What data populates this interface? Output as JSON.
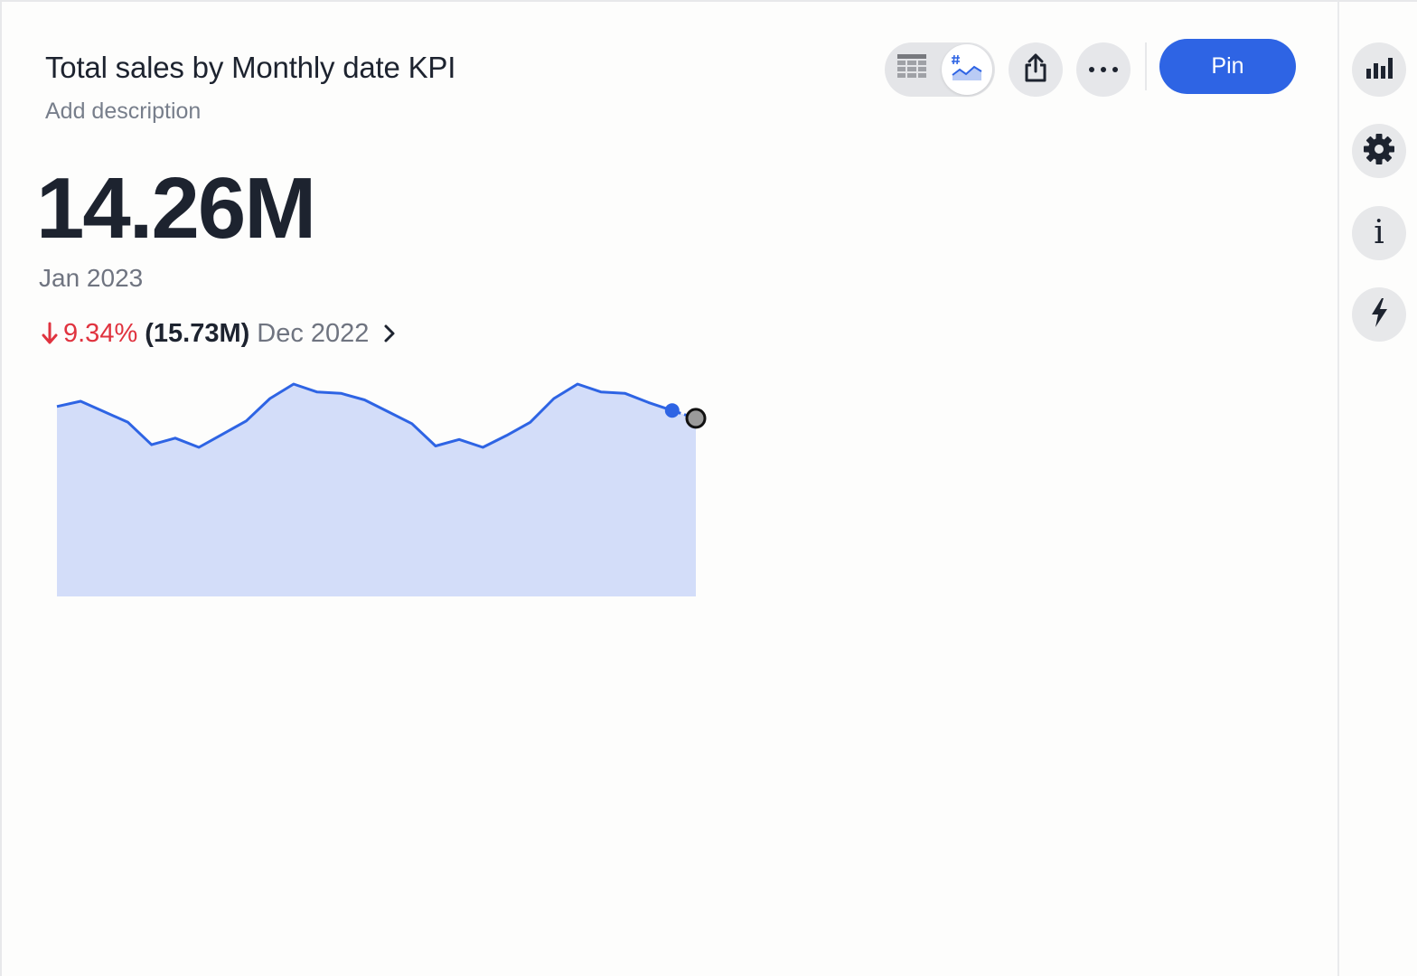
{
  "header": {
    "title": "Total sales by Monthly date KPI",
    "description": "Add description"
  },
  "kpi": {
    "value": "14.26M",
    "period": "Jan 2023",
    "change": {
      "direction": "down",
      "percent": "9.34%",
      "previous_value": "(15.73M)",
      "previous_period": "Dec 2022"
    }
  },
  "toolbar": {
    "view_toggle": {
      "options": [
        "table",
        "kpi"
      ],
      "selected": "kpi"
    },
    "share_icon": "share-icon",
    "more_icon": "more-icon",
    "pin_label": "Pin"
  },
  "side_rail": {
    "items": [
      "chart-icon",
      "gear-icon",
      "info-icon",
      "bolt-icon"
    ],
    "info_glyph": "i"
  },
  "colors": {
    "accent": "#2e64e4",
    "negative": "#e0333f",
    "area_fill": "#d3ddf9",
    "line": "#2e64e4"
  },
  "chart_data": {
    "type": "area",
    "values": [
      14.9,
      15.3,
      14.5,
      13.7,
      12.0,
      12.5,
      11.8,
      12.8,
      13.8,
      15.5,
      16.6,
      16.0,
      15.9,
      15.4,
      14.5,
      13.6,
      11.9,
      12.4,
      11.8,
      12.7,
      13.7,
      15.5,
      16.6,
      16.0,
      15.9,
      15.2,
      14.6,
      14.0
    ],
    "highlighted_index": 26,
    "projected_index": 27
  }
}
